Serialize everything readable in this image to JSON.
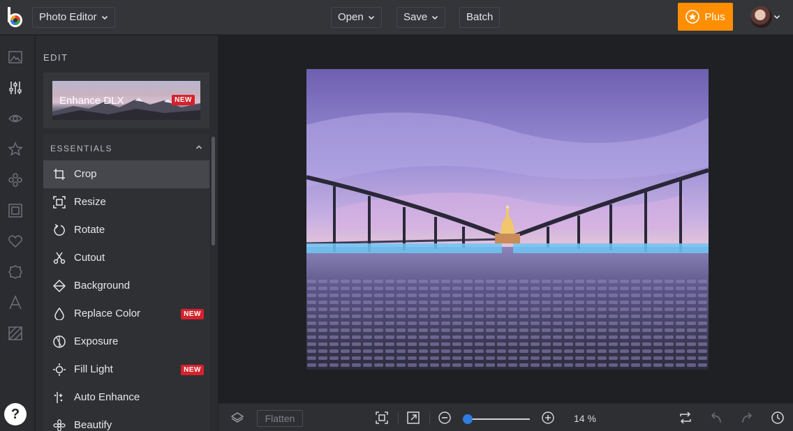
{
  "header": {
    "app_menu_label": "Photo Editor",
    "open_label": "Open",
    "save_label": "Save",
    "batch_label": "Batch",
    "plus_label": "Plus"
  },
  "rail": {
    "icons": [
      "image-icon",
      "adjustments-icon",
      "eye-icon",
      "star-icon",
      "effects-icon",
      "frame-icon",
      "heart-icon",
      "badge-icon",
      "text-icon",
      "texture-icon"
    ],
    "help_label": "?"
  },
  "panel": {
    "title": "EDIT",
    "enhance_card": {
      "label": "Enhance DLX",
      "badge": "NEW"
    },
    "section_title": "ESSENTIALS",
    "tools": [
      {
        "label": "Crop",
        "icon": "crop-icon",
        "badge": ""
      },
      {
        "label": "Resize",
        "icon": "resize-icon",
        "badge": ""
      },
      {
        "label": "Rotate",
        "icon": "rotate-icon",
        "badge": ""
      },
      {
        "label": "Cutout",
        "icon": "scissors-icon",
        "badge": ""
      },
      {
        "label": "Background",
        "icon": "background-icon",
        "badge": ""
      },
      {
        "label": "Replace Color",
        "icon": "drop-icon",
        "badge": "NEW"
      },
      {
        "label": "Exposure",
        "icon": "exposure-icon",
        "badge": ""
      },
      {
        "label": "Fill Light",
        "icon": "light-icon",
        "badge": "NEW"
      },
      {
        "label": "Auto Enhance",
        "icon": "sparkle-icon",
        "badge": ""
      },
      {
        "label": "Beautify",
        "icon": "flower-icon",
        "badge": ""
      }
    ]
  },
  "bottom": {
    "flatten_label": "Flatten",
    "zoom_value": "14 %",
    "zoom_fraction": 0.0
  },
  "colors": {
    "accent": "#ff8f00",
    "new_badge": "#d6222c",
    "slider": "#2f7de1"
  }
}
